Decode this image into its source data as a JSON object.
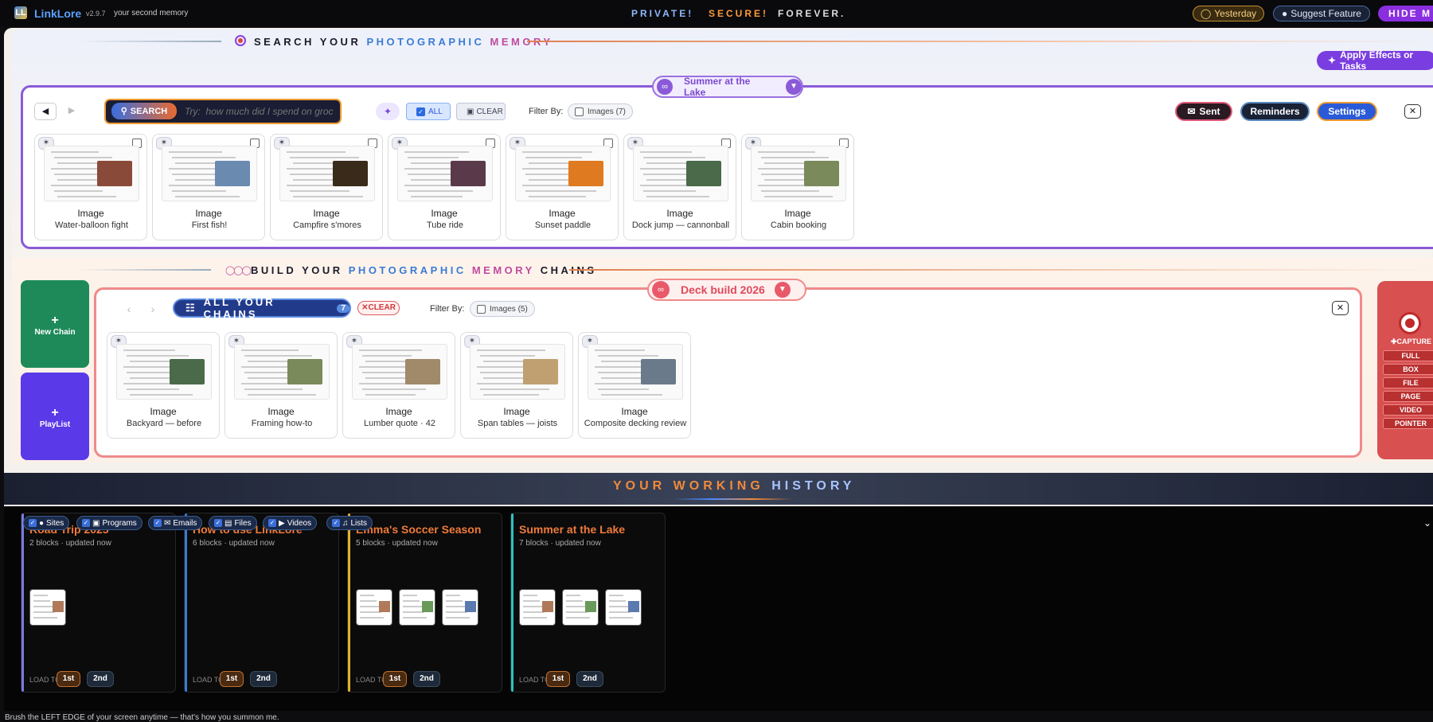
{
  "topbar": {
    "logo": "LL",
    "brand": "LinkLore",
    "version": "v2.9.7",
    "tagline": "your second memory",
    "motto": [
      "PRIVATE!",
      "SECURE!",
      "FOREVER."
    ],
    "yesterday": "Yesterday",
    "suggest": "Suggest Feature",
    "hide": "HIDE M"
  },
  "search_section": {
    "title_a": "SEARCH YOUR ",
    "title_b": "PHOTOGRAPHIC",
    "title_c": " MEMORY",
    "apply": "Apply Effects or Tasks",
    "chain_name": "Summer at the Lake",
    "search_label": "SEARCH",
    "search_placeholder": "Try:  how much did I spend on groc",
    "all": "ALL",
    "clear": "CLEAR",
    "filter_by": "Filter By:",
    "filter_images": "Images (7)",
    "sent": "Sent",
    "reminders": "Reminders",
    "settings": "Settings",
    "cards": [
      {
        "type": "Image",
        "name": "Water-balloon fight"
      },
      {
        "type": "Image",
        "name": "First fish!"
      },
      {
        "type": "Image",
        "name": "Campfire s'mores"
      },
      {
        "type": "Image",
        "name": "Tube ride"
      },
      {
        "type": "Image",
        "name": "Sunset paddle"
      },
      {
        "type": "Image",
        "name": "Dock jump — cannonball"
      },
      {
        "type": "Image",
        "name": "Cabin booking"
      }
    ]
  },
  "chains_section": {
    "title_a": "BUILD YOUR ",
    "title_b": "PHOTOGRAPHIC",
    "title_c": " MEMORY",
    "title_d": " CHAINS",
    "new_chain": "New Chain",
    "playlist": "PlayList",
    "chain_name": "Deck build 2026",
    "all_chains": "ALL YOUR CHAINS",
    "count": "7",
    "clear": "CLEAR",
    "filter_by": "Filter By:",
    "filter_images": "Images (5)",
    "cards": [
      {
        "type": "Image",
        "name": "Backyard — before"
      },
      {
        "type": "Image",
        "name": "Framing how-to"
      },
      {
        "type": "Image",
        "name": "Lumber quote · 42"
      },
      {
        "type": "Image",
        "name": "Span tables — joists"
      },
      {
        "type": "Image",
        "name": "Composite decking review"
      }
    ],
    "capture": {
      "title": "CAPTURE",
      "options": [
        "FULL",
        "BOX",
        "FILE",
        "PAGE",
        "VIDEO",
        "POINTER"
      ]
    }
  },
  "history": {
    "title_a": "YOUR WORKING ",
    "title_b": "HISTORY",
    "filters": [
      "Sites",
      "Programs",
      "Emails",
      "Files",
      "Videos",
      "Lists"
    ],
    "load_to": "LOAD TO",
    "first": "1st",
    "second": "2nd",
    "cards": [
      {
        "title": "Road Trip 2025",
        "meta": "2 blocks  ·  updated now",
        "color": "#7a7ae0"
      },
      {
        "title": "How to use LinkLore",
        "meta": "6 blocks  ·  updated now",
        "color": "#3a7bd5"
      },
      {
        "title": "Emma's Soccer Season",
        "meta": "5 blocks  ·  updated now",
        "color": "#e0b030"
      },
      {
        "title": "Summer at the Lake",
        "meta": "7 blocks  ·  updated now",
        "color": "#30c0c0"
      }
    ]
  },
  "footer": "Brush the LEFT EDGE of your screen anytime — that's how you summon me."
}
